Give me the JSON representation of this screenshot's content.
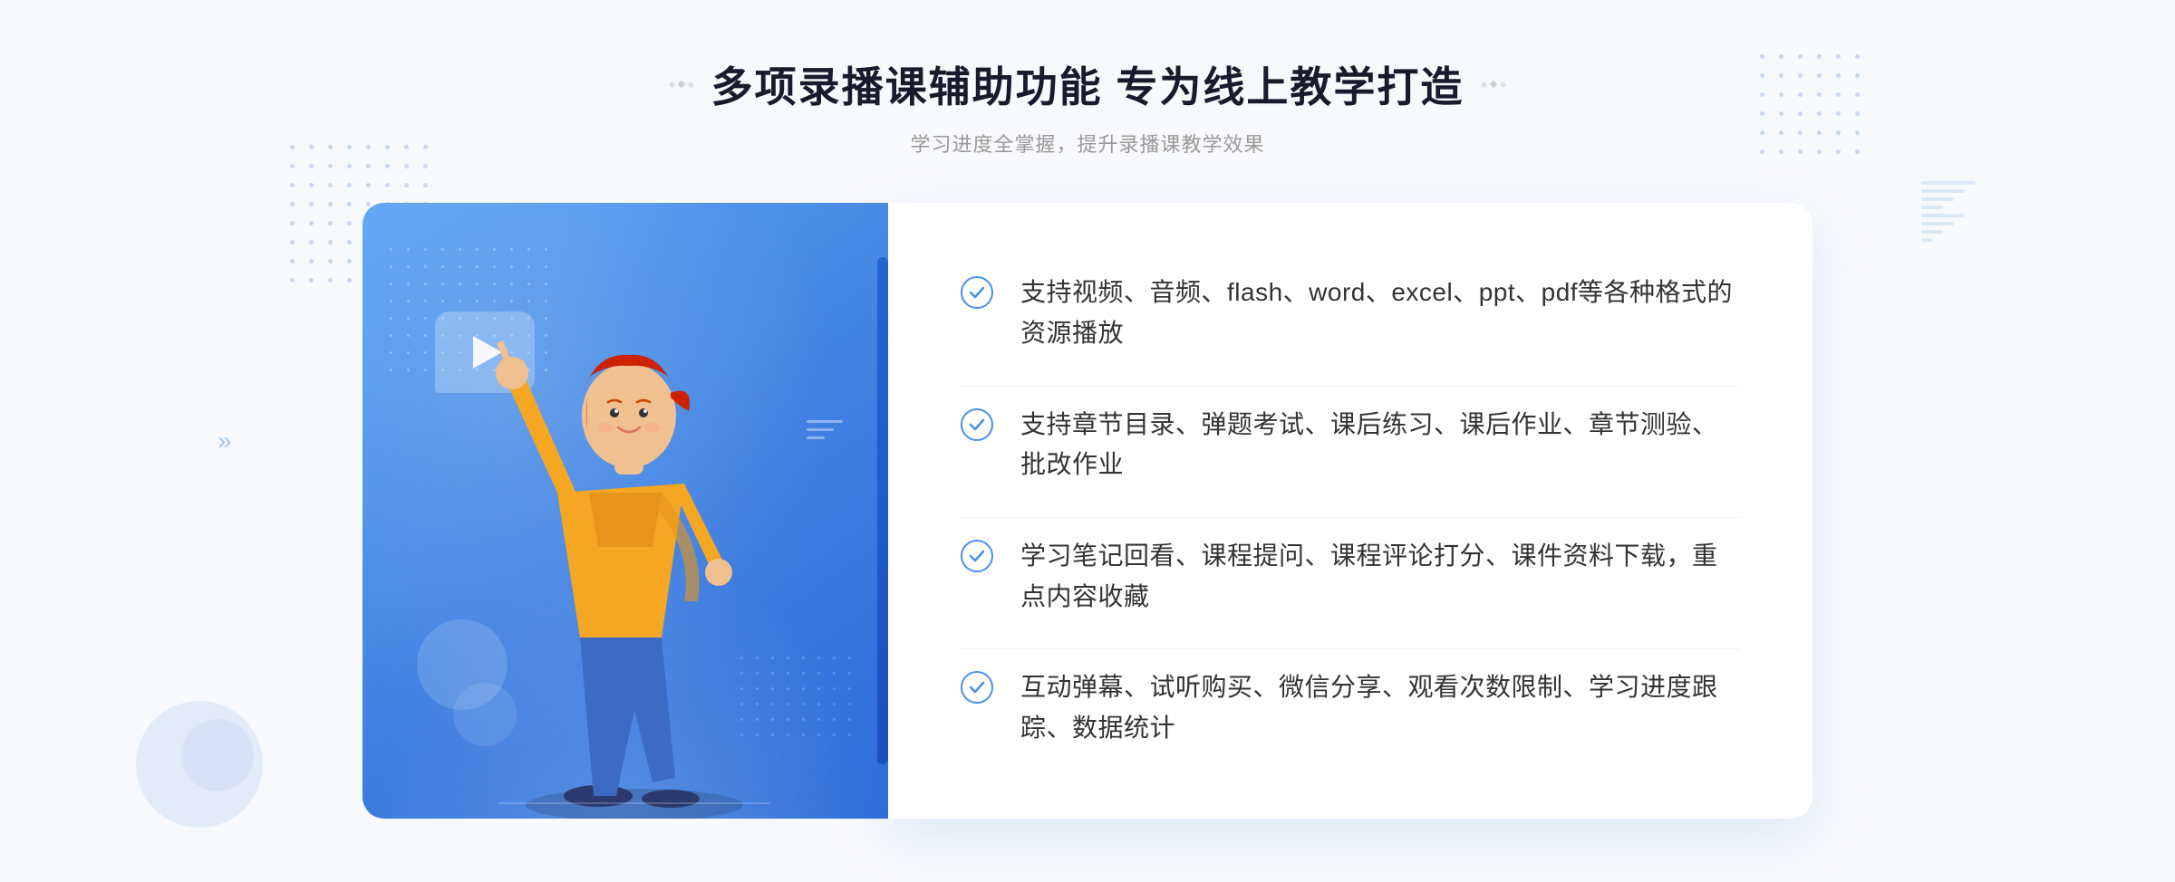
{
  "header": {
    "title": "多项录播课辅助功能 专为线上教学打造",
    "subtitle": "学习进度全掌握，提升录播课教学效果"
  },
  "features": [
    {
      "id": "feature-1",
      "text": "支持视频、音频、flash、word、excel、ppt、pdf等各种格式的资源播放"
    },
    {
      "id": "feature-2",
      "text": "支持章节目录、弹题考试、课后练习、课后作业、章节测验、批改作业"
    },
    {
      "id": "feature-3",
      "text": "学习笔记回看、课程提问、课程评论打分、课件资料下载，重点内容收藏"
    },
    {
      "id": "feature-4",
      "text": "互动弹幕、试听购买、微信分享、观看次数限制、学习进度跟踪、数据统计"
    }
  ],
  "decorators": {
    "left_label": ":::",
    "right_label": ":::"
  }
}
